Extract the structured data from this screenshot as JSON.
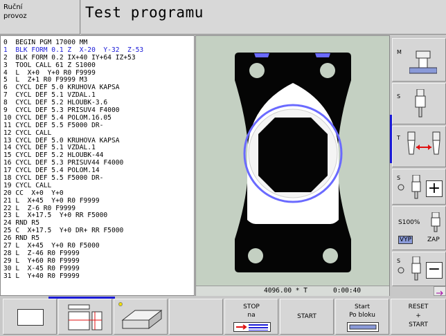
{
  "header": {
    "mode_line1": "Ruční",
    "mode_line2": "provoz",
    "title": "Test programu"
  },
  "program_lines": [
    "0  BEGIN PGM 17000 MM",
    "1  BLK FORM 0.1 Z  X-20  Y-32  Z-53",
    "2  BLK FORM 0.2 IX+40 IY+64 IZ+53",
    "3  TOOL CALL 61 Z S1000",
    "4  L  X+0  Y+0 R0 F9999",
    "5  L  Z+1 R0 F9999 M3",
    "6  CYCL DEF 5.0 KRUHOVA KAPSA",
    "7  CYCL DEF 5.1 VZDAL.1",
    "8  CYCL DEF 5.2 HLOUBK-3.6",
    "9  CYCL DEF 5.3 PRISUV4 F4000",
    "10 CYCL DEF 5.4 POLOM.16.05",
    "11 CYCL DEF 5.5 F5000 DR-",
    "12 CYCL CALL",
    "13 CYCL DEF 5.0 KRUHOVA KAPSA",
    "14 CYCL DEF 5.1 VZDAL.1",
    "15 CYCL DEF 5.2 HLOUBK-44",
    "16 CYCL DEF 5.3 PRISUV44 F4000",
    "17 CYCL DEF 5.4 POLOM.14",
    "18 CYCL DEF 5.5 F5000 DR-",
    "19 CYCL CALL",
    "20 CC  X+0  Y+0",
    "21 L  X+45  Y+0 R0 F9999",
    "22 L  Z-6 R0 F9999",
    "23 L  X+17.5  Y+0 RR F5000",
    "24 RND R5",
    "25 C  X+17.5  Y+0 DR+ RR F5000",
    "26 RND R5",
    "27 L  X+45  Y+0 R0 F5000",
    "28 L  Z-46 R0 F9999",
    "29 L  Y+60 R0 F9999",
    "30 L  X-45 R0 F9999",
    "31 L  Y+40 R0 F9999"
  ],
  "active_line": 1,
  "graphics_status": {
    "time": "4096.00 * T",
    "clock": "0:00:40"
  },
  "right_softkeys": {
    "m_label": "M",
    "s1_label": "S",
    "t_label": "T",
    "s2_label": "S",
    "plus": "+",
    "override_pct": "S100%",
    "vyp": "VYP",
    "zap": "ZAP",
    "s3_label": "S",
    "minus": "−"
  },
  "bottom_softkeys": {
    "stop_line1": "STOP",
    "stop_line2": "na",
    "start": "START",
    "start_block_line1": "Start",
    "start_block_line2": "Po bloku",
    "reset_line1": "RESET",
    "reset_line2": "+",
    "reset_line3": "START"
  },
  "colors": {
    "active_text": "#1b1bd8",
    "graphics_bg": "#c4d0c2",
    "part_black": "#050505",
    "pocket_white": "#ffffff",
    "pocket_blue": "#6a6aff",
    "arrow_red": "#e01010"
  }
}
